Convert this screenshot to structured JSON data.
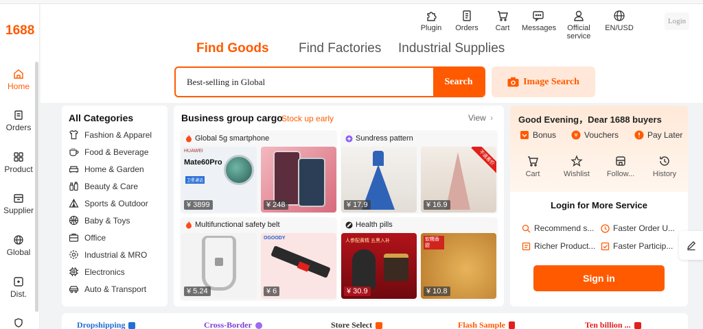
{
  "brand": {
    "logo": "1688",
    "accent": "#ff5a00"
  },
  "sidebar": {
    "items": [
      {
        "label": "Home",
        "icon": "home-icon",
        "active": true
      },
      {
        "label": "Orders",
        "icon": "orders-icon"
      },
      {
        "label": "Product",
        "icon": "product-icon"
      },
      {
        "label": "Supplier",
        "icon": "supplier-icon"
      },
      {
        "label": "Global",
        "icon": "globe-icon"
      },
      {
        "label": "Dist.",
        "icon": "distribution-icon"
      },
      {
        "label": "",
        "icon": "shield-icon"
      }
    ]
  },
  "header": {
    "nav": [
      {
        "label": "Plugin",
        "icon": "plugin-icon"
      },
      {
        "label": "Orders",
        "icon": "orders-icon"
      },
      {
        "label": "Cart",
        "icon": "cart-icon"
      },
      {
        "label": "Messages",
        "icon": "message-icon"
      },
      {
        "label": "Official service",
        "icon": "user-icon"
      },
      {
        "label": "EN/USD",
        "icon": "globe-icon"
      }
    ],
    "login": "Login"
  },
  "search": {
    "tabs": [
      {
        "label": "Find Goods",
        "active": true
      },
      {
        "label": "Find Factories"
      },
      {
        "label": "Industrial Supplies"
      }
    ],
    "value": "Best-selling in Global",
    "button": "Search",
    "image_search": "Image Search"
  },
  "categories": {
    "title": "All Categories",
    "items": [
      {
        "label": "Fashion & Apparel",
        "icon": "shirt-icon"
      },
      {
        "label": "Food & Beverage",
        "icon": "cup-icon"
      },
      {
        "label": "Home & Garden",
        "icon": "sofa-icon"
      },
      {
        "label": "Beauty & Care",
        "icon": "bottle-icon"
      },
      {
        "label": "Sports & Outdoor",
        "icon": "tent-icon"
      },
      {
        "label": "Baby & Toys",
        "icon": "ball-icon"
      },
      {
        "label": "Office",
        "icon": "briefcase-icon"
      },
      {
        "label": "Industrial & MRO",
        "icon": "gear-icon"
      },
      {
        "label": "Electronics",
        "icon": "chip-icon"
      },
      {
        "label": "Auto & Transport",
        "icon": "car-icon"
      }
    ]
  },
  "cargo": {
    "title": "Business group cargo",
    "subtitle": "Stock up early",
    "view": "View",
    "cards": [
      {
        "label": "Global 5g smartphone",
        "badge_icon": "fire-icon",
        "products": [
          {
            "price": "¥ 3899",
            "brand": "HUAWEI",
            "model": "Mate60Pro",
            "note": "卫星通话"
          },
          {
            "price": "¥ 248"
          }
        ]
      },
      {
        "label": "Sundress pattern",
        "badge_icon": "spark-icon",
        "products": [
          {
            "price": "¥ 17.9"
          },
          {
            "price": "¥ 16.9",
            "ribbon": "不退差价"
          }
        ]
      },
      {
        "label": "Multifunctional safety belt",
        "badge_icon": "fire-icon",
        "products": [
          {
            "price": "¥ 5.24"
          },
          {
            "price": "¥ 6",
            "brand": "OGOODY"
          }
        ]
      },
      {
        "label": "Health pills",
        "badge_icon": "pill-icon",
        "products": [
          {
            "price": "¥ 30.9",
            "note": "人参配黄精 五黑入补"
          },
          {
            "price": "¥ 10.8",
            "note": "软糯香甜"
          }
        ]
      }
    ]
  },
  "account": {
    "greeting": "Good Evening，Dear 1688 buyers",
    "perks": [
      {
        "label": "Bonus",
        "icon": "bonus-icon"
      },
      {
        "label": "Vouchers",
        "icon": "voucher-icon"
      },
      {
        "label": "Pay Later",
        "icon": "paylater-icon"
      }
    ],
    "quick": [
      {
        "label": "Cart",
        "icon": "cart-icon"
      },
      {
        "label": "Wishlist",
        "icon": "star-icon"
      },
      {
        "label": "Follow...",
        "icon": "store-icon"
      },
      {
        "label": "History",
        "icon": "history-icon"
      }
    ],
    "login_title": "Login for More Service",
    "services": [
      {
        "label": "Recommend s...",
        "icon": "search-icon"
      },
      {
        "label": "Faster Order U...",
        "icon": "clock-icon"
      },
      {
        "label": "Richer Product...",
        "icon": "doc-icon"
      },
      {
        "label": "Faster Particip...",
        "icon": "check-icon"
      }
    ],
    "signin": "Sign in"
  },
  "bottom": [
    {
      "label": "Dropshipping",
      "color": "#1f6fd6"
    },
    {
      "label": "Cross-Border",
      "color": "#7a3fd6"
    },
    {
      "label": "Store Select",
      "color": "#333333"
    },
    {
      "label": "Flash Sample",
      "color": "#ff5a00"
    },
    {
      "label": "Ten billion ...",
      "color": "#e0201b"
    }
  ]
}
